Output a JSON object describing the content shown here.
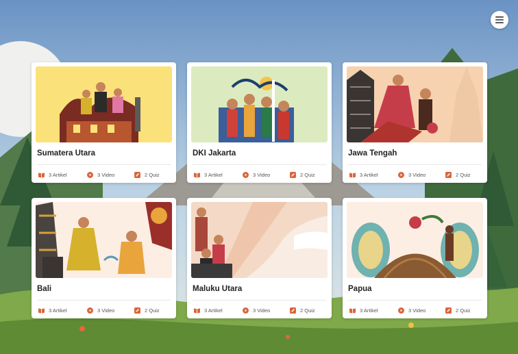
{
  "header": {
    "menu_icon": "hamburger-menu-icon"
  },
  "colors": {
    "accent": "#d9663a",
    "card_bg": "#ffffff",
    "sky_top": "#6a93c4"
  },
  "regions": [
    {
      "name": "Sumatera Utara",
      "articles": "3 Artikel",
      "videos": "3 Video",
      "quizzes": "2 Quiz",
      "illustration": "sumatera-utara-illustration",
      "bg": "#fbe17a"
    },
    {
      "name": "DKI Jakarta",
      "articles": "3 Artikel",
      "videos": "3 Video",
      "quizzes": "2 Quiz",
      "illustration": "dki-jakarta-illustration",
      "bg": "#dcebbf"
    },
    {
      "name": "Jawa Tengah",
      "articles": "3 Artikel",
      "videos": "3 Video",
      "quizzes": "2 Quiz",
      "illustration": "jawa-tengah-illustration",
      "bg": "#f6d2b0"
    },
    {
      "name": "Bali",
      "articles": "3 Artikel",
      "videos": "3 Video",
      "quizzes": "2 Quiz",
      "illustration": "bali-illustration",
      "bg": "#fdeee4"
    },
    {
      "name": "Maluku Utara",
      "articles": "3 Artikel",
      "videos": "3 Video",
      "quizzes": "2 Quiz",
      "illustration": "maluku-utara-illustration",
      "bg": "#f4d9c6"
    },
    {
      "name": "Papua",
      "articles": "3 Artikel",
      "videos": "3 Video",
      "quizzes": "2 Quiz",
      "illustration": "papua-illustration",
      "bg": "#fdeee4"
    }
  ]
}
